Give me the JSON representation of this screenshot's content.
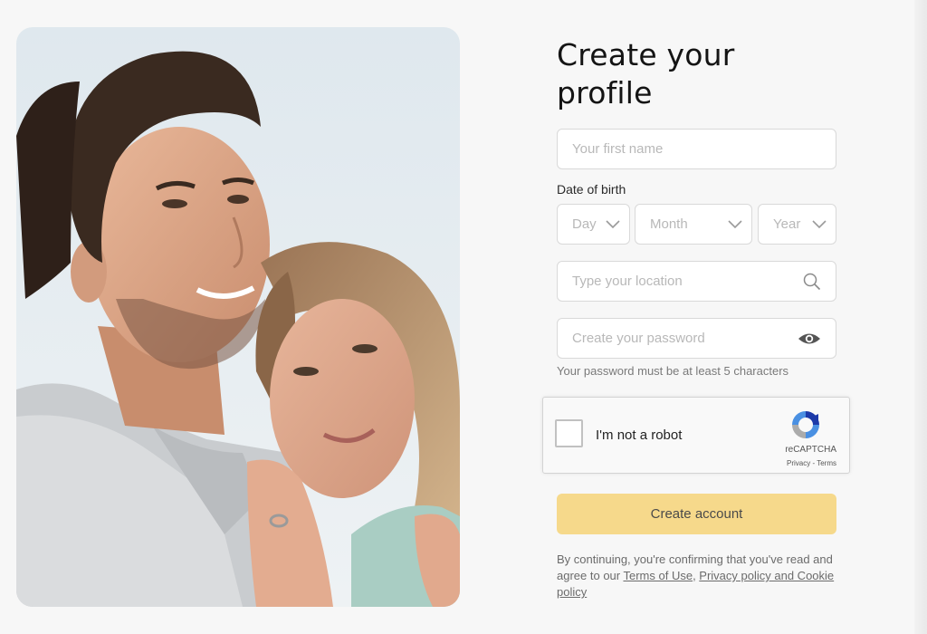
{
  "form": {
    "title_line1": "Create your",
    "title_line2": "profile",
    "first_name_placeholder": "Your first name",
    "dob_label": "Date of birth",
    "day_placeholder": "Day",
    "month_placeholder": "Month",
    "year_placeholder": "Year",
    "location_placeholder": "Type your location",
    "password_placeholder": "Create your password",
    "password_hint": "Your password must be at least 5 characters",
    "submit_label": "Create account",
    "legal_prefix": "By continuing, you're confirming that you've read and agree to our ",
    "terms_link": "Terms of Use",
    "separator": ", ",
    "privacy_link": "Privacy policy and Cookie policy"
  },
  "captcha": {
    "label": "I'm not a robot",
    "brand": "reCAPTCHA",
    "privacy": "Privacy",
    "dash": " - ",
    "terms": "Terms"
  },
  "colors": {
    "accent": "#f6d98b",
    "background": "#f7f7f7",
    "field_border": "#d9d9d9",
    "placeholder": "#b8b8b8"
  },
  "icons": {
    "location": "search-icon",
    "password": "eye-icon",
    "select": "chevron-down-icon"
  }
}
